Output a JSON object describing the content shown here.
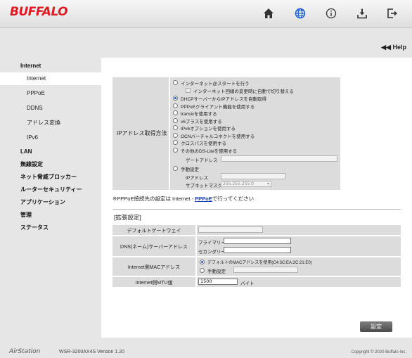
{
  "brand": "BUFFALO",
  "header": {
    "icons": [
      "home-icon",
      "globe-icon",
      "info-icon",
      "download-icon",
      "logout-icon"
    ],
    "help_label": "Help",
    "accent_color": "#1a5bd6",
    "brand_color": "#e01a22"
  },
  "sidebar": {
    "items": [
      {
        "label": "Internet",
        "level": 1
      },
      {
        "label": "Internet",
        "level": 2,
        "active": true
      },
      {
        "label": "PPPoE",
        "level": 2
      },
      {
        "label": "DDNS",
        "level": 2
      },
      {
        "label": "アドレス変換",
        "level": 2
      },
      {
        "label": "IPv6",
        "level": 2
      },
      {
        "label": "LAN",
        "level": 1
      },
      {
        "label": "無線設定",
        "level": 1
      },
      {
        "label": "ネット脅威ブロッカー",
        "level": 1
      },
      {
        "label": "ルーターセキュリティー",
        "level": 1
      },
      {
        "label": "アプリケーション",
        "level": 1
      },
      {
        "label": "管理",
        "level": 1
      },
      {
        "label": "ステータス",
        "level": 1
      }
    ]
  },
  "ip": {
    "label": "IPアドレス取得方法",
    "options": [
      "インターネット@スタートを行う",
      "インターネット回線の変更時に自動で切り替える",
      "DHCPサーバーからIPアドレスを自動取得",
      "PPPoEクライアント機能を使用する",
      "transixを使用する",
      "v6プラスを使用する",
      "IPv6オプションを使用する",
      "OCNバーチャルコネクトを使用する",
      "クロスパスを使用する",
      "その他のDS-Liteを使用する"
    ],
    "gateway_label": "ゲートアドレス",
    "manual_label": "手動設定",
    "ip_label": "IPアドレス",
    "subnet_label": "サブネットマスク",
    "subnet_value": "255.255.255.0"
  },
  "pppoe_note": {
    "prefix": "※PPPoE接続先の設定は Internet - ",
    "link": "PPPoE",
    "suffix": "で行ってください"
  },
  "extended": {
    "title": "[拡張設定]",
    "gateway_label": "デフォルトゲートウェイ",
    "dns_label": "DNS(ネーム)サーバーアドレス",
    "primary_label": "プライマリー:",
    "secondary_label": "セカンダリー:",
    "mac_label": "Internet側MACアドレス",
    "mac_default": "デフォルトのMACアドレスを使用(C4:3C:EA:2C:21:E0)",
    "mac_manual": "手動設定",
    "mtu_label": "Internet側MTU値",
    "mtu_value": "1500",
    "mtu_unit": "バイト"
  },
  "settings_button": "設定",
  "footer": {
    "logo": "AirStation",
    "model": "WSR-3200AX4S   Version 1.20",
    "copyright": "Copyright © 2020 Buffalo Inc."
  }
}
